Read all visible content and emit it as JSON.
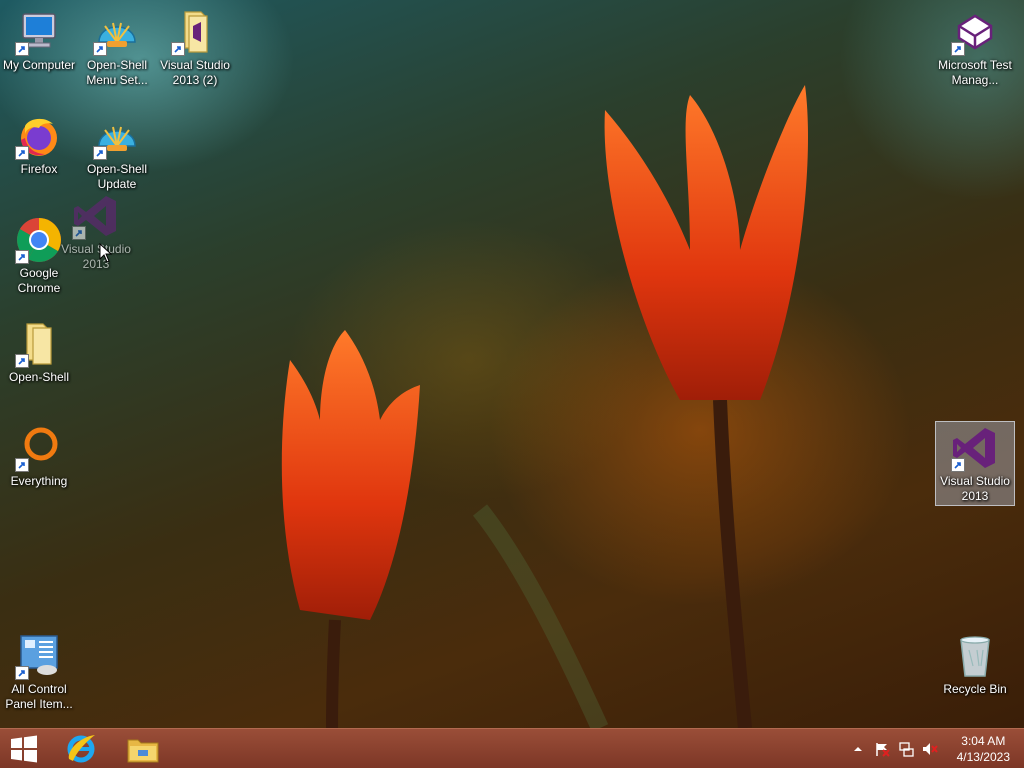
{
  "desktop": {
    "icons": [
      {
        "label": "My Computer",
        "icon": "computer-icon"
      },
      {
        "label": "Open-Shell Menu Set...",
        "icon": "shell-icon"
      },
      {
        "label": "Visual Studio 2013 (2)",
        "icon": "folder-vs-icon"
      },
      {
        "label": "Microsoft Test Manag...",
        "icon": "test-manager-icon"
      },
      {
        "label": "Firefox",
        "icon": "firefox-icon"
      },
      {
        "label": "Open-Shell Update",
        "icon": "shell-icon"
      },
      {
        "label": "Visual Studio 2013",
        "icon": "visual-studio-icon"
      },
      {
        "label": "Google Chrome",
        "icon": "chrome-icon"
      },
      {
        "label": "Open-Shell",
        "icon": "folder-icon"
      },
      {
        "label": "Everything",
        "icon": "everything-icon"
      },
      {
        "label": "Visual Studio 2013",
        "icon": "visual-studio-icon"
      },
      {
        "label": "All Control Panel Item...",
        "icon": "control-panel-icon"
      },
      {
        "label": "Recycle Bin",
        "icon": "recycle-bin-icon"
      }
    ]
  },
  "taskbar": {
    "start_icon": "windows-logo-icon",
    "pinned": [
      "internet-explorer-icon",
      "file-explorer-icon"
    ],
    "tray": [
      "show-hidden-icons-chevron",
      "action-center-flag-icon",
      "network-icon",
      "volume-muted-icon"
    ],
    "clock": {
      "time": "3:04 AM",
      "date": "4/13/2023"
    }
  },
  "colors": {
    "taskbar": "#8a4030",
    "vs_purple": "#68217a",
    "selection": "#c8dcff"
  }
}
